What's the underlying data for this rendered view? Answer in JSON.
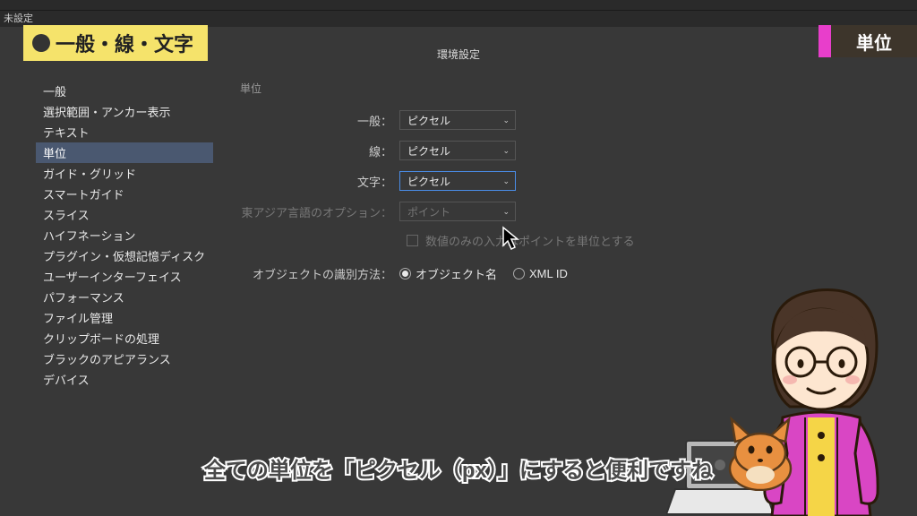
{
  "topbar_text": "未設定",
  "highlight_label": "一般・線・文字",
  "right_tab": "単位",
  "dialog_title": "環境設定",
  "sidebar": {
    "items": [
      {
        "label": "一般"
      },
      {
        "label": "選択範囲・アンカー表示"
      },
      {
        "label": "テキスト"
      },
      {
        "label": "単位"
      },
      {
        "label": "ガイド・グリッド"
      },
      {
        "label": "スマートガイド"
      },
      {
        "label": "スライス"
      },
      {
        "label": "ハイフネーション"
      },
      {
        "label": "プラグイン・仮想記憶ディスク"
      },
      {
        "label": "ユーザーインターフェイス"
      },
      {
        "label": "パフォーマンス"
      },
      {
        "label": "ファイル管理"
      },
      {
        "label": "クリップボードの処理"
      },
      {
        "label": "ブラックのアピアランス"
      },
      {
        "label": "デバイス"
      }
    ],
    "selected_index": 3
  },
  "main": {
    "section_title": "単位",
    "rows": {
      "general": {
        "label": "一般：",
        "value": "ピクセル"
      },
      "stroke": {
        "label": "線：",
        "value": "ピクセル"
      },
      "text": {
        "label": "文字：",
        "value": "ピクセル"
      },
      "asian": {
        "label": "東アジア言語のオプション：",
        "value": "ポイント"
      }
    },
    "checkbox_label": "数値のみの入力はポイントを単位とする",
    "identify": {
      "label": "オブジェクトの識別方法：",
      "opt1": "オブジェクト名",
      "opt2": "XML ID"
    }
  },
  "caption": "全ての単位を「ピクセル（px）」にすると便利ですね"
}
